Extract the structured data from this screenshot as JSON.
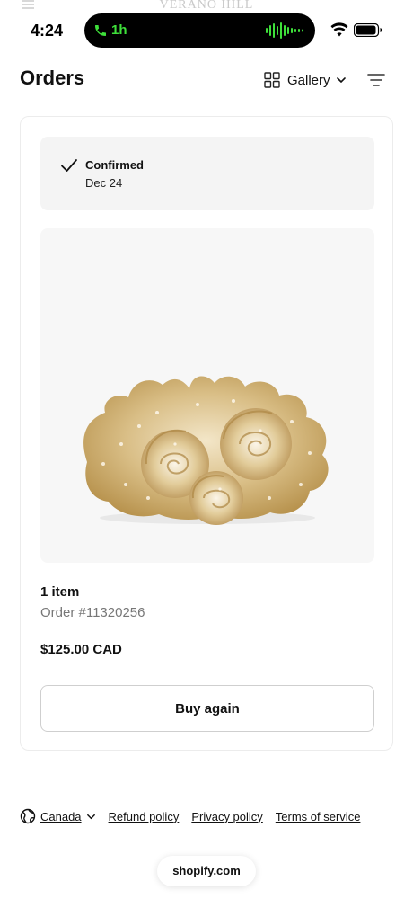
{
  "status_bar": {
    "time": "4:24",
    "call_duration": "1h",
    "brand_faded": "VERANO HILL"
  },
  "header": {
    "title": "Orders",
    "view_label": "Gallery"
  },
  "order": {
    "status": "Confirmed",
    "status_date": "Dec 24",
    "item_count": "1 item",
    "order_number": "Order #11320256",
    "total": "$125.00 CAD",
    "buy_again_label": "Buy again"
  },
  "footer": {
    "country": "Canada",
    "links": [
      "Refund policy",
      "Privacy policy",
      "Terms of service"
    ],
    "powered_by": "shopify.com"
  },
  "icons": {
    "phone": "phone-icon",
    "wifi": "wifi-icon",
    "battery": "battery-icon",
    "gallery": "grid-icon",
    "filter": "filter-icon",
    "status": "check-icon",
    "country": "globe-icon"
  },
  "colors": {
    "call_green": "#3ee03a",
    "status_box_bg": "#f4f4f4",
    "card_border": "#ececec"
  }
}
